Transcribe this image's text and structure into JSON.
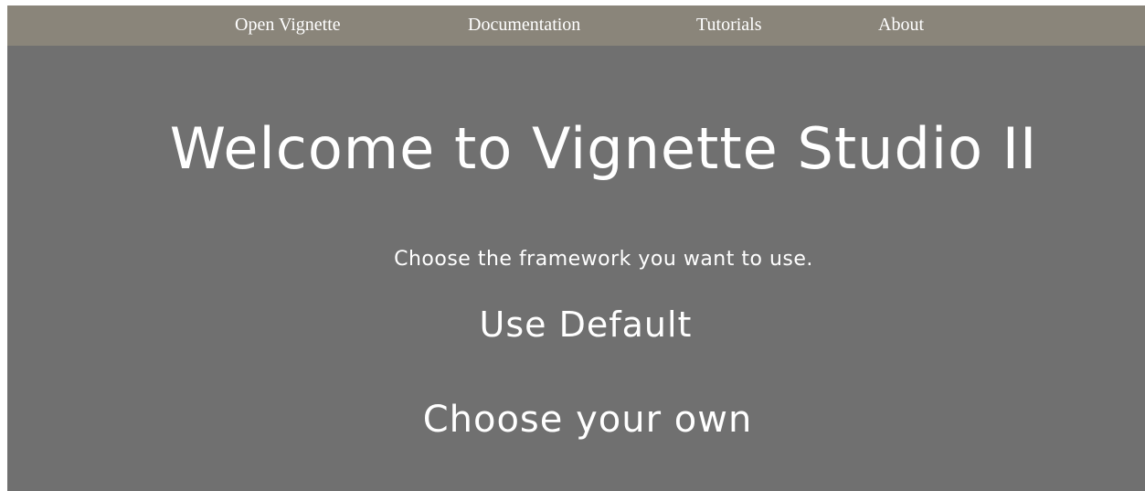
{
  "nav": {
    "items": [
      {
        "label": "Open Vignette"
      },
      {
        "label": "Documentation"
      },
      {
        "label": "Tutorials"
      },
      {
        "label": "About"
      }
    ]
  },
  "main": {
    "title": "Welcome to Vignette Studio II",
    "subtitle": "Choose the framework you want to use.",
    "options": [
      {
        "label": "Use Default"
      },
      {
        "label": "Choose your own"
      }
    ]
  },
  "colors": {
    "navbar": "#8a857a",
    "background": "#707070",
    "text": "#ffffff"
  }
}
